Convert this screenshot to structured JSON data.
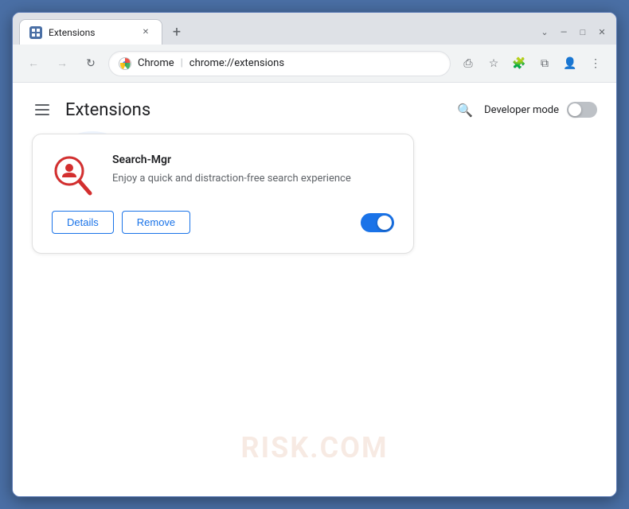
{
  "window": {
    "title": "Extensions",
    "tab_label": "Extensions",
    "close_label": "✕",
    "minimize_label": "—",
    "maximize_label": "□",
    "chevron_label": "⌄"
  },
  "addressbar": {
    "chrome_label": "Chrome",
    "separator": "|",
    "url": "chrome://extensions"
  },
  "toolbar": {
    "back_label": "←",
    "forward_label": "→",
    "reload_label": "↻",
    "share_label": "⎙",
    "bookmark_label": "☆",
    "extensions_label": "🧩",
    "split_label": "⧉",
    "profile_label": "👤",
    "menu_label": "⋮"
  },
  "page": {
    "hamburger_label": "☰",
    "title": "Extensions",
    "search_label": "🔍",
    "developer_mode_label": "Developer mode",
    "developer_mode_on": false
  },
  "extension": {
    "name": "Search-Mgr",
    "description": "Enjoy a quick and distraction-free search experience",
    "details_label": "Details",
    "remove_label": "Remove",
    "enabled": true
  },
  "watermark": {
    "text": "RISK.COM"
  }
}
